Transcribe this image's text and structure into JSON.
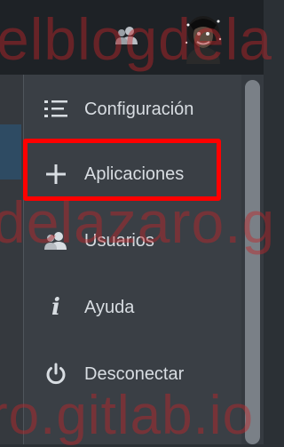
{
  "menu": {
    "items": [
      {
        "label": "Configuración",
        "icon": "list-icon"
      },
      {
        "label": "Aplicaciones",
        "icon": "plus-icon"
      },
      {
        "label": "Usuarios",
        "icon": "users-icon"
      },
      {
        "label": "Ayuda",
        "icon": "info-icon"
      },
      {
        "label": "Desconectar",
        "icon": "power-icon"
      }
    ]
  },
  "watermark": {
    "line1": "elblogdela",
    "line2": "delazaro.g",
    "line3": "ro.gitlab.io"
  },
  "colors": {
    "highlight": "#ff0000",
    "watermark": "#c0262a",
    "menu_bg": "#3a3f45"
  }
}
